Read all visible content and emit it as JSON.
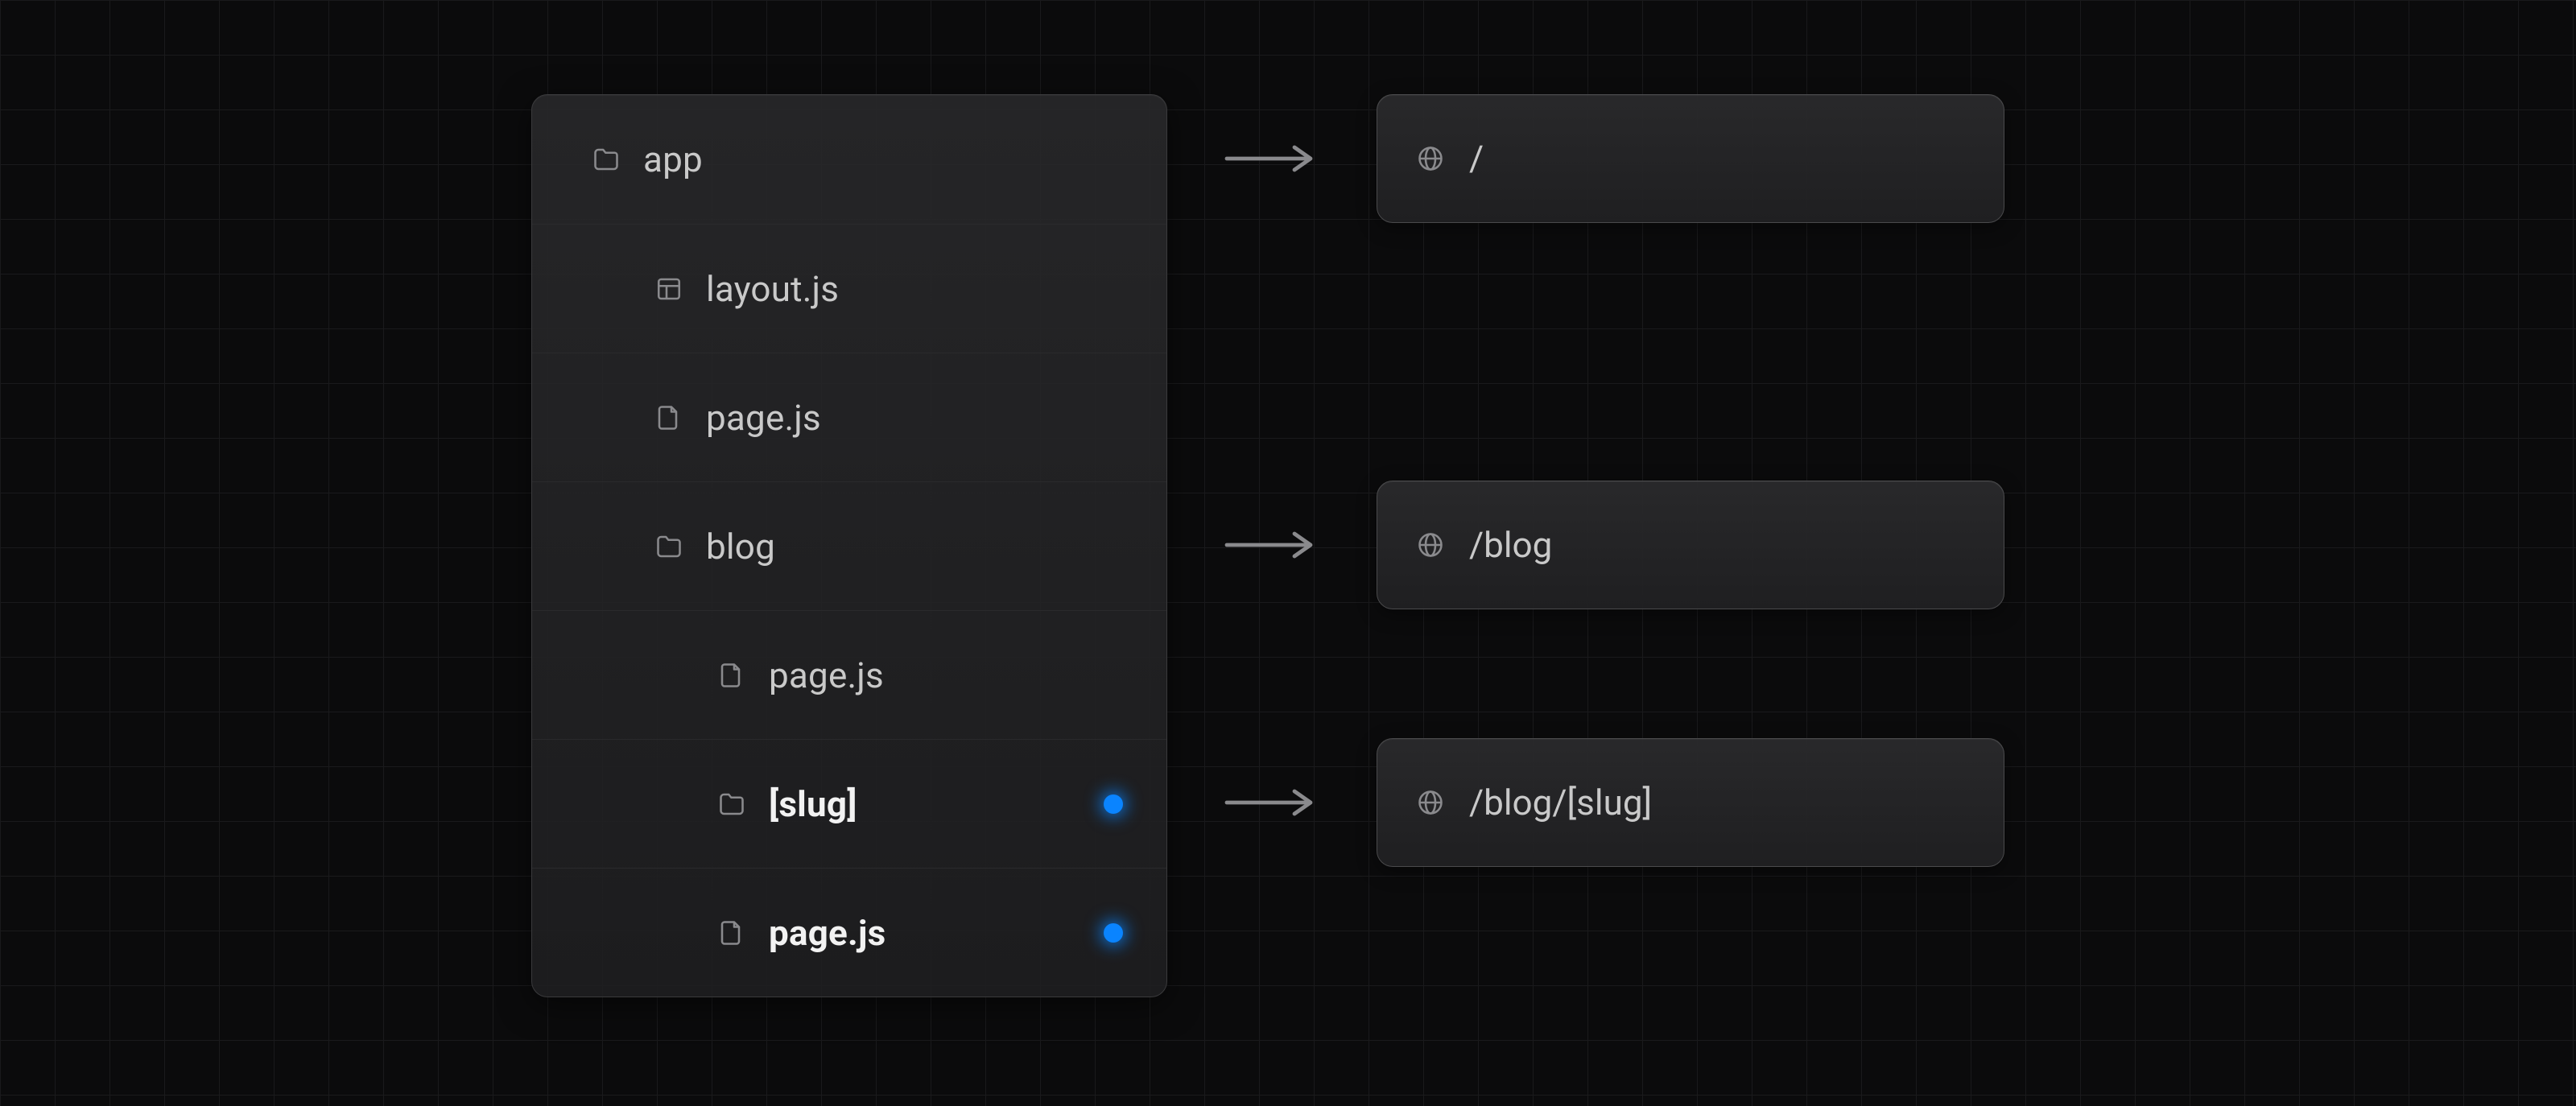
{
  "tree": {
    "rows": [
      {
        "id": "app",
        "icon": "folder",
        "label": "app",
        "depth": 0,
        "bold": false,
        "dot": false,
        "route": "/"
      },
      {
        "id": "app-layout",
        "icon": "layout",
        "label": "layout.js",
        "depth": 1,
        "bold": false,
        "dot": false,
        "route": null
      },
      {
        "id": "app-page",
        "icon": "file",
        "label": "page.js",
        "depth": 1,
        "bold": false,
        "dot": false,
        "route": null
      },
      {
        "id": "blog",
        "icon": "folder",
        "label": "blog",
        "depth": 1,
        "bold": false,
        "dot": false,
        "route": "/blog"
      },
      {
        "id": "blog-page",
        "icon": "file",
        "label": "page.js",
        "depth": 2,
        "bold": false,
        "dot": false,
        "route": null
      },
      {
        "id": "slug",
        "icon": "folder",
        "label": "[slug]",
        "depth": 2,
        "bold": true,
        "dot": true,
        "route": "/blog/[slug]"
      },
      {
        "id": "slug-page",
        "icon": "file",
        "label": "page.js",
        "depth": 2,
        "bold": true,
        "dot": true,
        "route": null
      }
    ]
  },
  "icons": {
    "folder": "folder-icon",
    "file": "file-icon",
    "layout": "layout-icon",
    "globe": "globe-icon",
    "arrow": "arrow-right-icon"
  },
  "colors": {
    "dot": "#0a84ff",
    "background": "#0b0b0c",
    "panel": "#1f1f21"
  }
}
